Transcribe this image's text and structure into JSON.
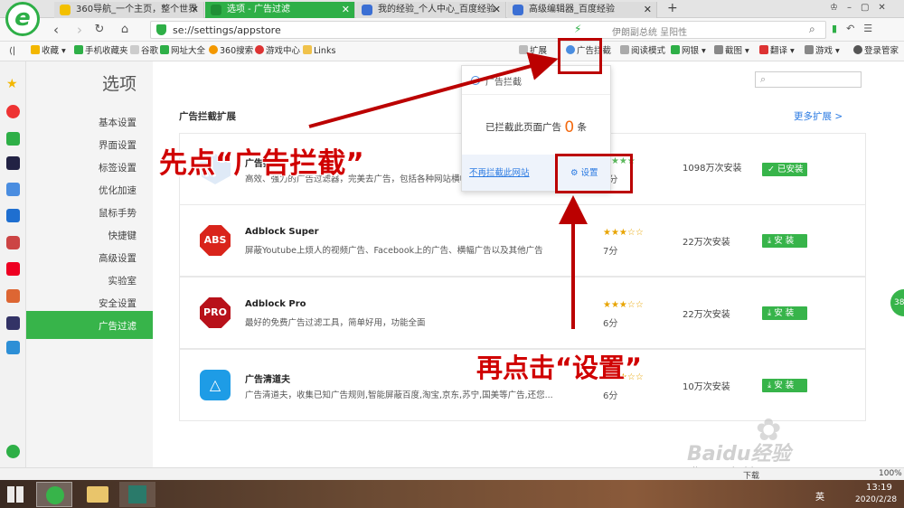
{
  "tabs": [
    {
      "title": "360导航_一个主页，整个世界"
    },
    {
      "title": "选项 - 广告过滤"
    },
    {
      "title": "我的经验_个人中心_百度经验"
    },
    {
      "title": "高级编辑器_百度经验"
    }
  ],
  "new_tab": "+",
  "address": {
    "url": "se://settings/appstore",
    "search_hint": "伊朗副总统 呈阳性"
  },
  "bookmarks": [
    "收藏",
    "手机收藏夹",
    "谷歌",
    "网址大全",
    "360搜索",
    "游戏中心",
    "Links"
  ],
  "toolbar": {
    "extensions": "扩展",
    "adblock": "广告拦截",
    "reader": "阅读模式",
    "netbank": "网银",
    "screenshot": "截图",
    "translate": "翻译",
    "games": "游戏",
    "login": "登录管家"
  },
  "page_title": "选项",
  "sidebar": [
    {
      "label": "基本设置"
    },
    {
      "label": "界面设置"
    },
    {
      "label": "标签设置"
    },
    {
      "label": "优化加速"
    },
    {
      "label": "鼠标手势"
    },
    {
      "label": "快捷键"
    },
    {
      "label": "高级设置"
    },
    {
      "label": "实验室"
    },
    {
      "label": "安全设置"
    },
    {
      "label": "广告过滤",
      "active": true
    }
  ],
  "section_title": "广告拦截扩展",
  "more_link": "更多扩展 >",
  "extensions": [
    {
      "name": "广告拦截",
      "desc": "高效、强力的广告过滤器，完美去广告，包括各种网站横幅",
      "stars": "★★★★",
      "score": "9分",
      "installs": "1098万次安装",
      "button": "已安装",
      "logo": "shield"
    },
    {
      "name": "Adblock Super",
      "desc": "屏蔽Youtube上烦人的视频广告、Facebook上的广告、横幅广告以及其他广告",
      "stars": "★★★☆☆",
      "score": "7分",
      "installs": "22万次安装",
      "button": "安 装",
      "logo": "ABS"
    },
    {
      "name": "Adblock Pro",
      "desc": "最好的免费广告过滤工具，简单好用，功能全面",
      "stars": "★★★☆☆",
      "score": "6分",
      "installs": "22万次安装",
      "button": "安 装",
      "logo": "PRO"
    },
    {
      "name": "广告清道夫",
      "desc": "广告清道夫，收集已知广告规则,智能屏蔽百度,淘宝,京东,苏宁,国美等广告,还您...",
      "stars": "★★★☆☆",
      "score": "6分",
      "installs": "10万次安装",
      "button": "安 装",
      "logo": "tri"
    }
  ],
  "popup": {
    "header": "广告拦截",
    "blocked_prefix": "已拦截此页面广告",
    "blocked_count": "0",
    "blocked_suffix": "条",
    "stop_link": "不再拦截此网站",
    "settings": "设置"
  },
  "annotations": {
    "step1": "先点“广告拦截”",
    "step2": "再点击“设置”"
  },
  "right_badge": "38",
  "status": {
    "zoom": "100%",
    "download": "下载"
  },
  "watermark": {
    "logo": "Baidu经验",
    "url": "jingyan.baidu.com"
  },
  "taskbar": {
    "time": "13:19",
    "date": "2020/2/28",
    "ime": "英"
  },
  "colors": {
    "accent": "#37b44a",
    "annotation": "#d00000",
    "link": "#2a7ae2"
  }
}
